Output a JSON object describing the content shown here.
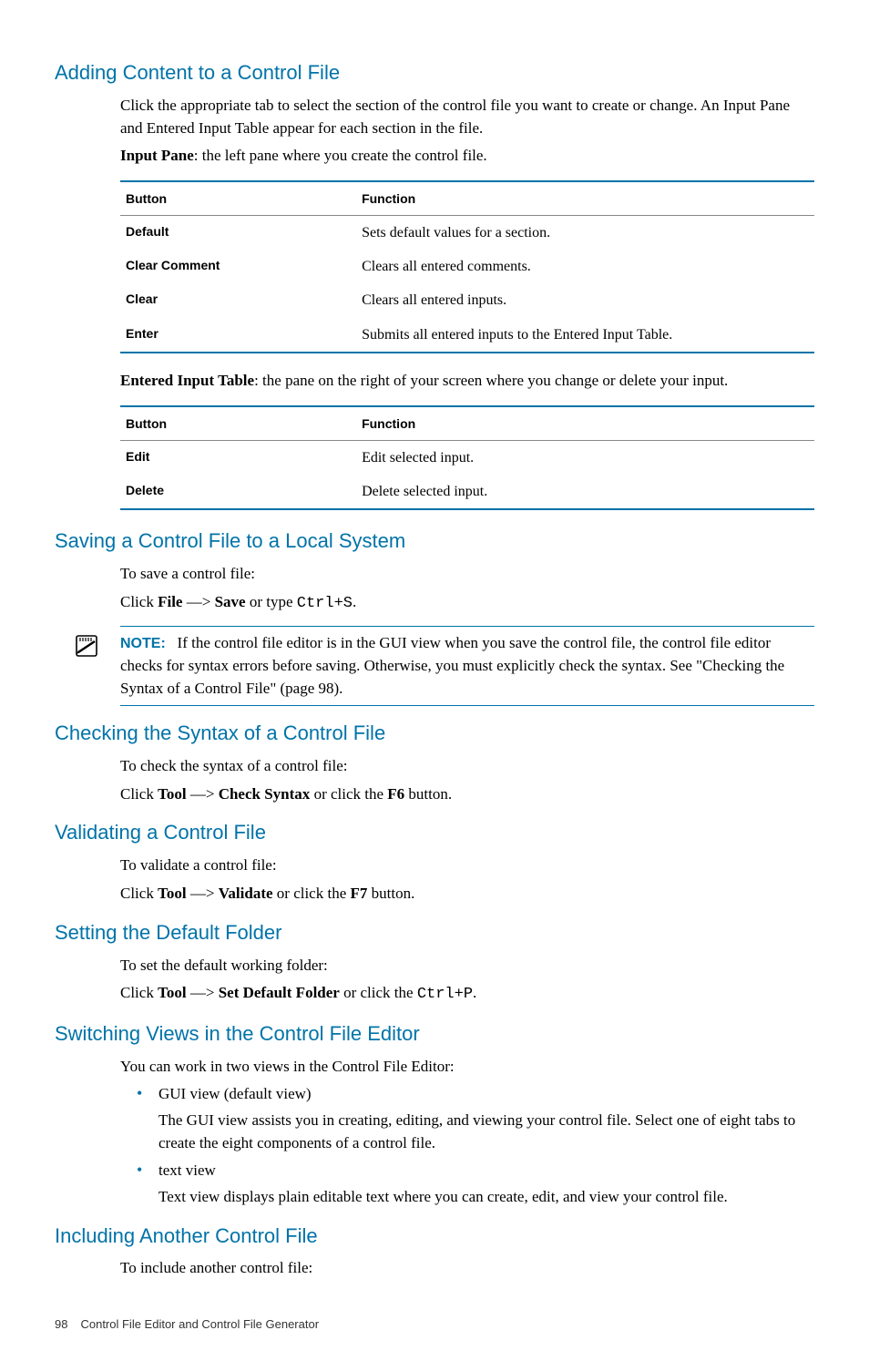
{
  "section1": {
    "heading": "Adding Content to a Control File",
    "p1": "Click the appropriate tab to select the section of the control file you want to create or change. An Input Pane and Entered Input Table appear for each section in the file.",
    "p2_bold": "Input Pane",
    "p2_rest": ": the left pane where you create the control file.",
    "table1": {
      "h1": "Button",
      "h2": "Function",
      "rows": [
        {
          "b": "Default",
          "f": "Sets default values for a section."
        },
        {
          "b": "Clear Comment",
          "f": "Clears all entered comments."
        },
        {
          "b": "Clear",
          "f": "Clears all entered inputs."
        },
        {
          "b": "Enter",
          "f": "Submits all entered inputs to the Entered Input Table."
        }
      ]
    },
    "p3_bold": "Entered Input Table",
    "p3_rest": ": the pane on the right of your screen where you change or delete your input.",
    "table2": {
      "h1": "Button",
      "h2": "Function",
      "rows": [
        {
          "b": "Edit",
          "f": "Edit selected input."
        },
        {
          "b": "Delete",
          "f": "Delete selected input."
        }
      ]
    }
  },
  "section2": {
    "heading": "Saving a Control File to a Local System",
    "p1": "To save a control file:",
    "p2_click": "Click ",
    "p2_file": "File",
    "p2_arrow": " —> ",
    "p2_save": "Save",
    "p2_ortype": " or type ",
    "p2_ctrls": "Ctrl+S",
    "p2_end": ".",
    "note_label": "NOTE:",
    "note_body": "If the control file editor is in the GUI view when you save the control file, the control file editor checks for syntax errors before saving. Otherwise, you must explicitly check the syntax. See \"Checking the Syntax of a Control File\" (page 98)."
  },
  "section3": {
    "heading": "Checking the Syntax of a Control File",
    "p1": "To check the syntax of a control file:",
    "p2_click": "Click ",
    "p2_tool": "Tool",
    "p2_arrow": " —> ",
    "p2_check": "Check Syntax",
    "p2_orclick": " or click the ",
    "p2_f6": "F6",
    "p2_end": " button."
  },
  "section4": {
    "heading": "Validating a Control File",
    "p1": "To validate a control file:",
    "p2_click": "Click ",
    "p2_tool": "Tool",
    "p2_arrow": " —> ",
    "p2_validate": "Validate",
    "p2_orclick": " or click the ",
    "p2_f7": "F7",
    "p2_end": " button."
  },
  "section5": {
    "heading": "Setting the Default Folder",
    "p1": "To set the default working folder:",
    "p2_click": "Click ",
    "p2_tool": "Tool",
    "p2_arrow": " —> ",
    "p2_setdef": "Set Default Folder",
    "p2_orclick": " or click the ",
    "p2_ctrlp": "Ctrl+P",
    "p2_end": "."
  },
  "section6": {
    "heading": "Switching Views in the Control File Editor",
    "p1": "You can work in two views in the Control File Editor:",
    "li1": "GUI view (default view)",
    "li1_desc": "The GUI view assists you in creating, editing, and viewing your control file. Select one of eight tabs to create the eight components of a control file.",
    "li2": "text view",
    "li2_desc": "Text view displays plain editable text where you can create, edit, and view your control file."
  },
  "section7": {
    "heading": "Including Another Control File",
    "p1": "To include another control file:"
  },
  "footer": {
    "page": "98",
    "title": "Control File Editor and Control File Generator"
  }
}
